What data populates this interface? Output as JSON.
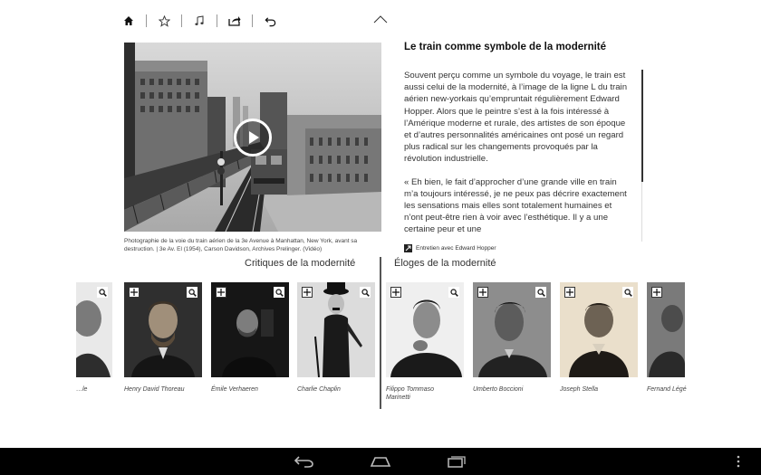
{
  "article": {
    "title": "Le train comme symbole de la modernité",
    "paragraph1": "Souvent perçu comme un symbole du voyage, le train est aussi celui de la modernité, à l’image de la ligne L du train aérien new-yorkais qu’empruntait régulièrement Edward Hopper. Alors que le peintre s’est à la fois intéressé à l’Amérique moderne et rurale, des artistes de son époque et d’autres personnalités américaines ont posé un regard plus radical sur les changements provoqués par la révolution industrielle.",
    "paragraph2": "« Eh bien, le fait d’approcher d’une grande ville en train m’a toujours intéressé, je ne peux pas décrire exactement les sensations mais elles sont totalement humaines et n’ont peut-être rien à voir avec l’esthétique. Il y a une certaine peur et une",
    "interview_link": "Entretien avec Edward Hopper"
  },
  "video": {
    "caption": "Photographie de la voie du train aérien de la 3e Avenue à Manhattan, New York, avant sa destruction. | 3e Av. El (1954), Carson Davidson, Archives Prelinger. (Vidéo)"
  },
  "sections": {
    "critiques": "Critiques de la modernité",
    "eloges": "Éloges de la modernité"
  },
  "people": [
    {
      "name": "…le",
      "bg": "#e8e8e8"
    },
    {
      "name": "Henry David Thoreau",
      "bg": "#3a3a3a"
    },
    {
      "name": "Émile Verhaeren",
      "bg": "#1a1a1a"
    },
    {
      "name": "Charlie Chaplin",
      "bg": "#d8d8d8"
    },
    {
      "name": "Filippo Tommaso Marinetti",
      "bg": "#f2f2f2"
    },
    {
      "name": "Umberto Boccioni",
      "bg": "#8a8a8a"
    },
    {
      "name": "Joseph Stella",
      "bg": "#e8dcc8"
    },
    {
      "name": "Fernand Légé",
      "bg": "#777777"
    }
  ],
  "icons": {
    "home": "home-icon",
    "favorite": "star-icon",
    "music": "music-note-icon",
    "share": "share-icon",
    "undo": "undo-icon",
    "collapse": "chevron-up-icon",
    "play": "play-icon",
    "add": "plus-icon",
    "zoom": "magnifier-icon"
  }
}
